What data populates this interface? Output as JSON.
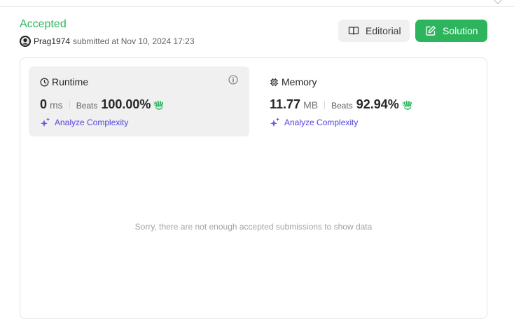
{
  "status": {
    "label": "Accepted",
    "color": "#2db55d"
  },
  "submission": {
    "username": "Prag1974",
    "submitted_text": "submitted at Nov 10, 2024 17:23"
  },
  "buttons": {
    "editorial": {
      "label": "Editorial",
      "icon": "book-open-icon"
    },
    "solution": {
      "label": "Solution",
      "icon": "edit-square-icon"
    }
  },
  "runtime": {
    "title": "Runtime",
    "icon": "clock-icon",
    "value": "0",
    "unit": "ms",
    "beats_label": "Beats",
    "beats_value": "100.00%",
    "analyze_label": "Analyze Complexity"
  },
  "memory": {
    "title": "Memory",
    "icon": "chip-icon",
    "value": "11.77",
    "unit": "MB",
    "beats_label": "Beats",
    "beats_value": "92.94%",
    "analyze_label": "Analyze Complexity"
  },
  "chart": {
    "empty_message": "Sorry, there are not enough accepted submissions to show data"
  },
  "colors": {
    "accent_green": "#2db55d",
    "analyze_gradient_start": "#8b3fdc",
    "analyze_gradient_end": "#3f7fe0"
  }
}
